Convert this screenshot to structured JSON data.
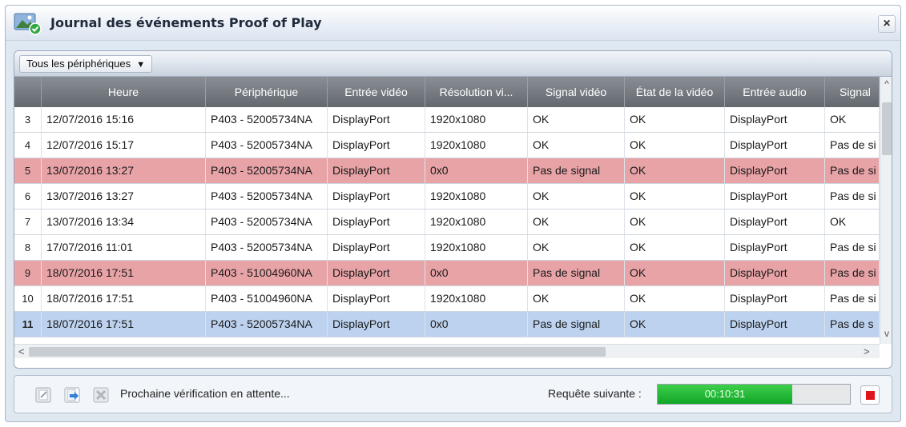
{
  "window": {
    "title": "Journal des événements Proof of Play",
    "close_glyph": "×",
    "app_icon": "image-check-icon"
  },
  "filter": {
    "selected": "Tous les périphériques",
    "caret": "▼"
  },
  "table": {
    "columns": [
      "",
      "Heure",
      "Périphérique",
      "Entrée vidéo",
      "Résolution vi...",
      "Signal vidéo",
      "État de la vidéo",
      "Entrée audio",
      "Signal"
    ],
    "rows": [
      {
        "num": "3",
        "heure": "12/07/2016 15:16",
        "peripherique": "P403 - 52005734NA",
        "entree_video": "DisplayPort",
        "resolution": "1920x1080",
        "signal_video": "OK",
        "etat_video": "OK",
        "entree_audio": "DisplayPort",
        "signal_audio": "OK",
        "state": "normal"
      },
      {
        "num": "4",
        "heure": "12/07/2016 15:17",
        "peripherique": "P403 - 52005734NA",
        "entree_video": "DisplayPort",
        "resolution": "1920x1080",
        "signal_video": "OK",
        "etat_video": "OK",
        "entree_audio": "DisplayPort",
        "signal_audio": "Pas de si",
        "state": "normal"
      },
      {
        "num": "5",
        "heure": "13/07/2016 13:27",
        "peripherique": "P403 - 52005734NA",
        "entree_video": "DisplayPort",
        "resolution": "0x0",
        "signal_video": "Pas de signal",
        "etat_video": "OK",
        "entree_audio": "DisplayPort",
        "signal_audio": "Pas de si",
        "state": "error"
      },
      {
        "num": "6",
        "heure": "13/07/2016 13:27",
        "peripherique": "P403 - 52005734NA",
        "entree_video": "DisplayPort",
        "resolution": "1920x1080",
        "signal_video": "OK",
        "etat_video": "OK",
        "entree_audio": "DisplayPort",
        "signal_audio": "Pas de si",
        "state": "normal"
      },
      {
        "num": "7",
        "heure": "13/07/2016 13:34",
        "peripherique": "P403 - 52005734NA",
        "entree_video": "DisplayPort",
        "resolution": "1920x1080",
        "signal_video": "OK",
        "etat_video": "OK",
        "entree_audio": "DisplayPort",
        "signal_audio": "OK",
        "state": "normal"
      },
      {
        "num": "8",
        "heure": "17/07/2016 11:01",
        "peripherique": "P403 - 52005734NA",
        "entree_video": "DisplayPort",
        "resolution": "1920x1080",
        "signal_video": "OK",
        "etat_video": "OK",
        "entree_audio": "DisplayPort",
        "signal_audio": "Pas de si",
        "state": "normal"
      },
      {
        "num": "9",
        "heure": "18/07/2016 17:51",
        "peripherique": "P403 - 51004960NA",
        "entree_video": "DisplayPort",
        "resolution": "0x0",
        "signal_video": "Pas de signal",
        "etat_video": "OK",
        "entree_audio": "DisplayPort",
        "signal_audio": "Pas de si",
        "state": "error"
      },
      {
        "num": "10",
        "heure": "18/07/2016 17:51",
        "peripherique": "P403 - 51004960NA",
        "entree_video": "DisplayPort",
        "resolution": "1920x1080",
        "signal_video": "OK",
        "etat_video": "OK",
        "entree_audio": "DisplayPort",
        "signal_audio": "Pas de si",
        "state": "normal"
      },
      {
        "num": "11",
        "heure": "18/07/2016 17:51",
        "peripherique": "P403 - 52005734NA",
        "entree_video": "DisplayPort",
        "resolution": "0x0",
        "signal_video": "Pas de signal",
        "etat_video": "OK",
        "entree_audio": "DisplayPort",
        "signal_audio": "Pas de s",
        "state": "selected"
      }
    ]
  },
  "scrollbars": {
    "up": "^",
    "down": "v",
    "left": "<",
    "right": ">"
  },
  "status": {
    "message": "Prochaine vérification en attente...",
    "next_label": "Requête suivante :",
    "countdown": "00:10:31",
    "progress_fraction": 0.7,
    "icons": [
      "edit-icon",
      "export-icon",
      "clear-icon",
      "stop-icon"
    ]
  },
  "colors": {
    "error_row": "#e8a3a7",
    "selected_row": "#bcd2ee",
    "progress": "#1fb533",
    "stop": "#e0151b"
  }
}
